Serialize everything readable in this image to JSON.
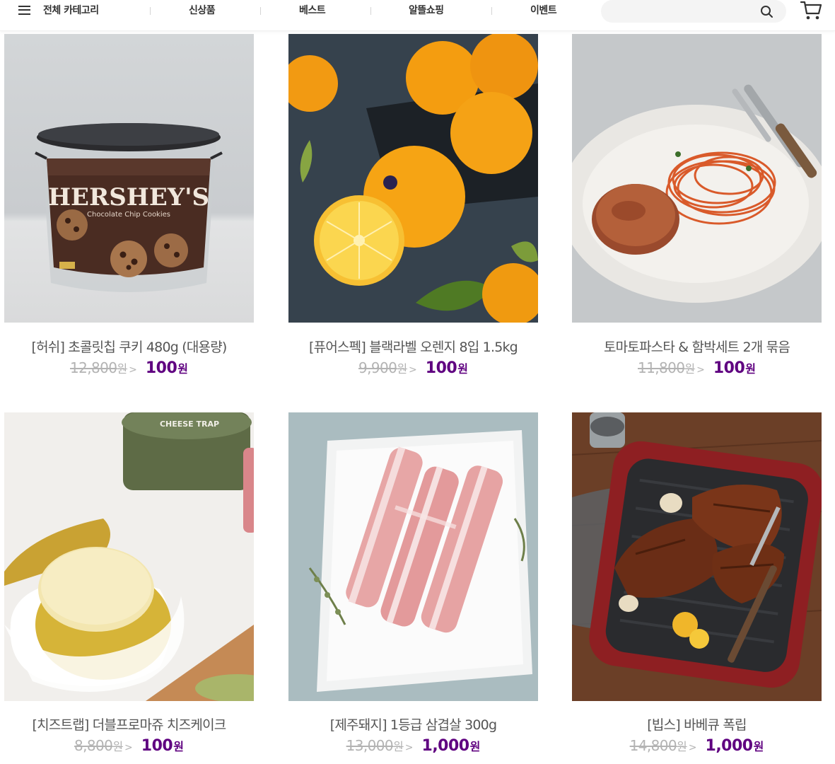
{
  "nav": {
    "category_label": "전체 카테고리",
    "items": [
      "신상품",
      "베스트",
      "알뜰쇼핑",
      "이벤트"
    ],
    "search_placeholder": ""
  },
  "colors": {
    "accent": "#5f0080",
    "original_price": "#b3b3b3",
    "product_name": "#555555"
  },
  "products": [
    {
      "name": "[허쉬] 초콜릿칩 쿠키 480g (대용량)",
      "original_price": "12,800",
      "sale_price": "100",
      "currency": "원",
      "image": "hersheys-cookie-tub"
    },
    {
      "name": "[퓨어스펙] 블랙라벨 오렌지 8입 1.5kg",
      "original_price": "9,900",
      "sale_price": "100",
      "currency": "원",
      "image": "oranges"
    },
    {
      "name": "토마토파스타 & 함박세트 2개 묶음",
      "original_price": "11,800",
      "sale_price": "100",
      "currency": "원",
      "image": "tomato-pasta-hamburg"
    },
    {
      "name": "[치즈트랩] 더블프로마쥬 치즈케이크",
      "original_price": "8,800",
      "sale_price": "100",
      "currency": "원",
      "image": "cheesecake-tin"
    },
    {
      "name": "[제주돼지] 1등급 삼겹살 300g",
      "original_price": "13,000",
      "sale_price": "1,000",
      "currency": "원",
      "image": "pork-belly"
    },
    {
      "name": "[빕스] 바베큐 폭립",
      "original_price": "14,800",
      "sale_price": "1,000",
      "currency": "원",
      "image": "bbq-pork-ribs"
    }
  ],
  "image_labels": {
    "hersheys_brand": "HERSHEY'S",
    "hersheys_sub": "Chocolate Chip Cookies",
    "cheese_trap": "CHEESE TRAP"
  }
}
